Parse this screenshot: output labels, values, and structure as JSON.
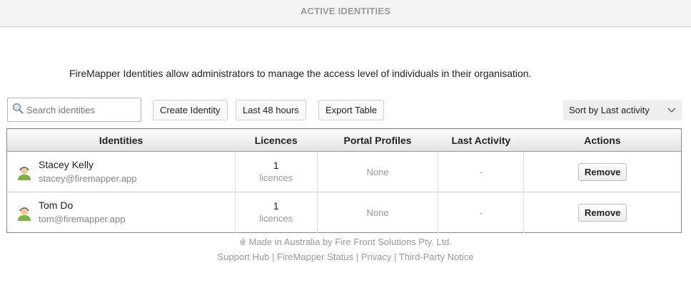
{
  "header": {
    "title": "ACTIVE IDENTITIES"
  },
  "intro": "FireMapper Identities allow administrators to manage the access level of individuals in their organisation.",
  "toolbar": {
    "search_placeholder": "Search identities",
    "create_label": "Create Identity",
    "last48_label": "Last 48 hours",
    "export_label": "Export Table",
    "sort_label": "Sort by Last activity"
  },
  "table": {
    "columns": [
      "Identities",
      "Licences",
      "Portal Profiles",
      "Last Activity",
      "Actions"
    ],
    "rows": [
      {
        "name": "Stacey Kelly",
        "email": "stacey@firemapper.app",
        "licence_count": "1",
        "licence_label": "licences",
        "portal_profiles": "None",
        "last_activity": "-",
        "action": "Remove"
      },
      {
        "name": "Tom Do",
        "email": "tom@firemapper.app",
        "licence_count": "1",
        "licence_label": "licences",
        "portal_profiles": "None",
        "last_activity": "-",
        "action": "Remove"
      }
    ]
  },
  "footer": {
    "made_in": "Made in Australia by Fire Front Solutions Pty. Ltd.",
    "links": [
      "Support Hub",
      "FireMapper Status",
      "Privacy",
      "Third-Party Notice"
    ],
    "separator": "|"
  },
  "icons": {
    "search": "search-icon",
    "flame": "flame-icon",
    "avatar": "user-avatar-icon",
    "chevron": "chevron-down-icon"
  }
}
